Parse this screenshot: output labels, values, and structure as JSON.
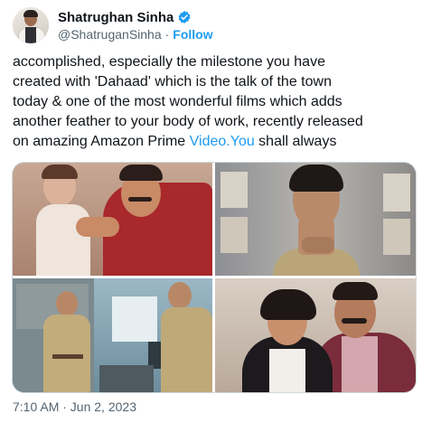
{
  "author": {
    "name": "Shatrughan Sinha",
    "handle": "@ShatruganSinha",
    "separator": "·",
    "follow_label": "Follow",
    "verified_color": "#1d9bf0"
  },
  "tweet": {
    "line1": "accomplished, especially the milestone you have",
    "line2": "created with 'Dahaad' which is the talk of the town",
    "line3": "today & one of the most wonderful films which adds",
    "line4": "another feather to your body of work, recently released",
    "line5_pre": "on amazing Amazon Prime ",
    "line5_link": "Video.You",
    "line5_post": " shall always"
  },
  "media": {
    "photo_count": 4,
    "photos": [
      "childhood-photo-with-father",
      "police-officer-portrait",
      "police-officers-in-office",
      "father-daughter-portrait"
    ]
  },
  "timestamp": "7:10 AM · Jun 2, 2023",
  "colors": {
    "link": "#1d9bf0",
    "secondary_text": "#536471",
    "primary_text": "#0f1419",
    "border": "#cfd9de"
  }
}
